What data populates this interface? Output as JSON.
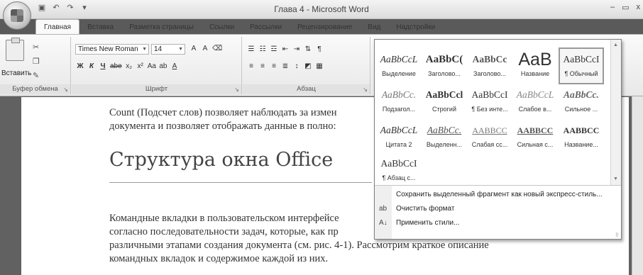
{
  "titlebar": {
    "title": "Глава 4 - Microsoft Word",
    "qat_icons": [
      "save-icon",
      "undo-icon",
      "redo-icon",
      "customize-icon"
    ],
    "controls": [
      "–",
      "▭",
      "x"
    ]
  },
  "tabs": [
    "Главная",
    "Вставка",
    "Разметка страницы",
    "Ссылки",
    "Рассылки",
    "Рецензирование",
    "Вид",
    "Надстройки"
  ],
  "ribbon": {
    "clipboard": {
      "paste_label": "Вставить",
      "group_label": "Буфер обмена"
    },
    "font": {
      "name": "Times New Roman",
      "size": "14",
      "group_label": "Шрифт",
      "row1_buttons": [
        "A",
        "A"
      ],
      "row2_buttons": [
        "Ж",
        "К",
        "Ч",
        "abe",
        "x₂",
        "x²",
        "Aa",
        "ab",
        "A"
      ]
    },
    "paragraph": {
      "group_label": "Абзац"
    }
  },
  "document": {
    "para1_line1": "Count (Подсчет слов) позволяет наблюдать за измен",
    "para1_line2": "документа и позволяет отображать данные в полно:",
    "heading": "Структура окна Office",
    "para2_line1": "Командные вкладки в пользовательском интерфейсе",
    "para2_line2": "согласно последовательности задач, которые, как пр",
    "para2_line3": "различными этапами создания документа (см. рис. 4-1). Рассмотрим краткое описание",
    "para2_line4": "командных вкладок и содержимое каждой из них."
  },
  "gallery": {
    "styles": [
      {
        "sample": "AaBbCcL",
        "caption": "Выделение"
      },
      {
        "sample": "AaBbC(",
        "caption": "Заголово..."
      },
      {
        "sample": "AaBbCc",
        "caption": "Заголово..."
      },
      {
        "sample": "AaB",
        "caption": "Название"
      },
      {
        "sample": "AaBbCcI",
        "caption": "¶ Обычный"
      },
      {
        "sample": "AaBbCc.",
        "caption": "Подзагол..."
      },
      {
        "sample": "AaBbCcl",
        "caption": "Строгий"
      },
      {
        "sample": "AaBbCcI",
        "caption": "¶ Без инте..."
      },
      {
        "sample": "AaBbCcL",
        "caption": "Слабое в..."
      },
      {
        "sample": "AaBbCc.",
        "caption": "Сильное ..."
      },
      {
        "sample": "AaBbCcL",
        "caption": "Цитата 2"
      },
      {
        "sample": "AaBbCc.",
        "caption": "Выделенн..."
      },
      {
        "sample": "AABBCC",
        "caption": "Слабая сс..."
      },
      {
        "sample": "AABBCC",
        "caption": "Сильная с..."
      },
      {
        "sample": "AABBCC",
        "caption": "Название..."
      },
      {
        "sample": "AaBbCcI",
        "caption": "¶ Абзац с..."
      }
    ],
    "commands": [
      {
        "label": "Сохранить выделенный фрагмент как новый экспресс-стиль...",
        "icon": ""
      },
      {
        "label": "Очистить формат",
        "icon": "clear-format-icon"
      },
      {
        "label": "Применить стили...",
        "icon": "apply-styles-icon"
      }
    ],
    "selected_index": 4
  }
}
